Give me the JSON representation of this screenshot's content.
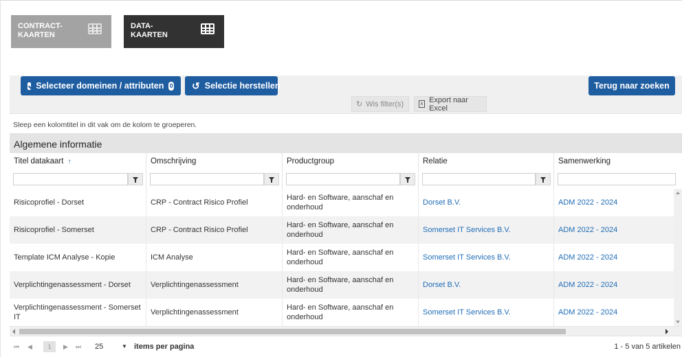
{
  "cards": [
    {
      "label": "CONTRACT-\nKAARTEN",
      "icon": "table-icon"
    },
    {
      "label": "DATA-\nKAARTEN",
      "icon": "table-icon"
    }
  ],
  "toolbar": {
    "select_label": "Selecteer domeinen / attributen",
    "select_count": "0",
    "reset_label": "Selectie herstellen",
    "back_label": "Terug naar zoeken",
    "clear_filters_label": "Wis filter(s)",
    "export_label": "Export naar Excel"
  },
  "grid": {
    "group_hint": "Sleep een kolomtitel in dit vak om de kolom te groeperen.",
    "band_title": "Algemene informatie",
    "columns": [
      "Titel datakaart",
      "Omschrijving",
      "Productgroup",
      "Relatie",
      "Samenwerking"
    ],
    "sort_indicator": "↑",
    "rows": [
      [
        "Risicoprofiel - Dorset",
        "CRP - Contract Risico Profiel",
        "Hard- en Software, aanschaf en onderhoud",
        "Dorset B.V.",
        "ADM 2022 - 2024"
      ],
      [
        "Risicoprofiel - Somerset",
        "CRP - Contract Risico Profiel",
        "Hard- en Software, aanschaf en onderhoud",
        "Somerset IT Services B.V.",
        "ADM 2022 - 2024"
      ],
      [
        "Template ICM Analyse - Kopie",
        "ICM Analyse",
        "Hard- en Software, aanschaf en onderhoud",
        "Somerset IT Services B.V.",
        "ADM 2022 - 2024"
      ],
      [
        "Verplichtingenassessment - Dorset",
        "Verplichtingenassessment",
        "Hard- en Software, aanschaf en onderhoud",
        "Dorset B.V.",
        "ADM 2022 - 2024"
      ],
      [
        "Verplichtingenassessment - Somerset IT",
        "Verplichtingenassessment",
        "Hard- en Software, aanschaf en onderhoud",
        "Somerset IT Services B.V.",
        "ADM 2022 - 2024"
      ]
    ]
  },
  "pager": {
    "current_page": "1",
    "page_size": "25",
    "items_per_page_label": "items per pagina",
    "info": "1 - 5 van 5 artikelen"
  }
}
